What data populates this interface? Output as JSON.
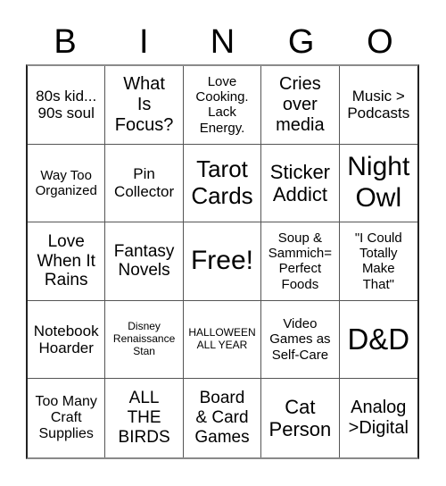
{
  "header": {
    "letters": [
      "B",
      "I",
      "N",
      "G",
      "O"
    ]
  },
  "cells": [
    {
      "text": "80s kid...\n90s soul"
    },
    {
      "text": "What\nIs\nFocus?"
    },
    {
      "text": "Love\nCooking.\nLack\nEnergy."
    },
    {
      "text": "Cries\nover\nmedia"
    },
    {
      "text": "Music >\nPodcasts"
    },
    {
      "text": "Way Too\nOrganized"
    },
    {
      "text": "Pin\nCollector"
    },
    {
      "text": "Tarot\nCards"
    },
    {
      "text": "Sticker\nAddict"
    },
    {
      "text": "Night\nOwl"
    },
    {
      "text": "Love\nWhen It\nRains"
    },
    {
      "text": "Fantasy\nNovels"
    },
    {
      "text": "Free!"
    },
    {
      "text": "Soup &\nSammich=\nPerfect\nFoods"
    },
    {
      "text": "\"I Could\nTotally\nMake\nThat\""
    },
    {
      "text": "Notebook\nHoarder"
    },
    {
      "text": "Disney\nRenaissance\nStan"
    },
    {
      "text": "HALLOWEEN\nALL YEAR"
    },
    {
      "text": "Video\nGames as\nSelf-Care"
    },
    {
      "text": "D&D"
    },
    {
      "text": "Too Many\nCraft\nSupplies"
    },
    {
      "text": "ALL\nTHE\nBIRDS"
    },
    {
      "text": "Board\n& Card\nGames"
    },
    {
      "text": "Cat\nPerson"
    },
    {
      "text": "Analog\n>Digital"
    }
  ]
}
